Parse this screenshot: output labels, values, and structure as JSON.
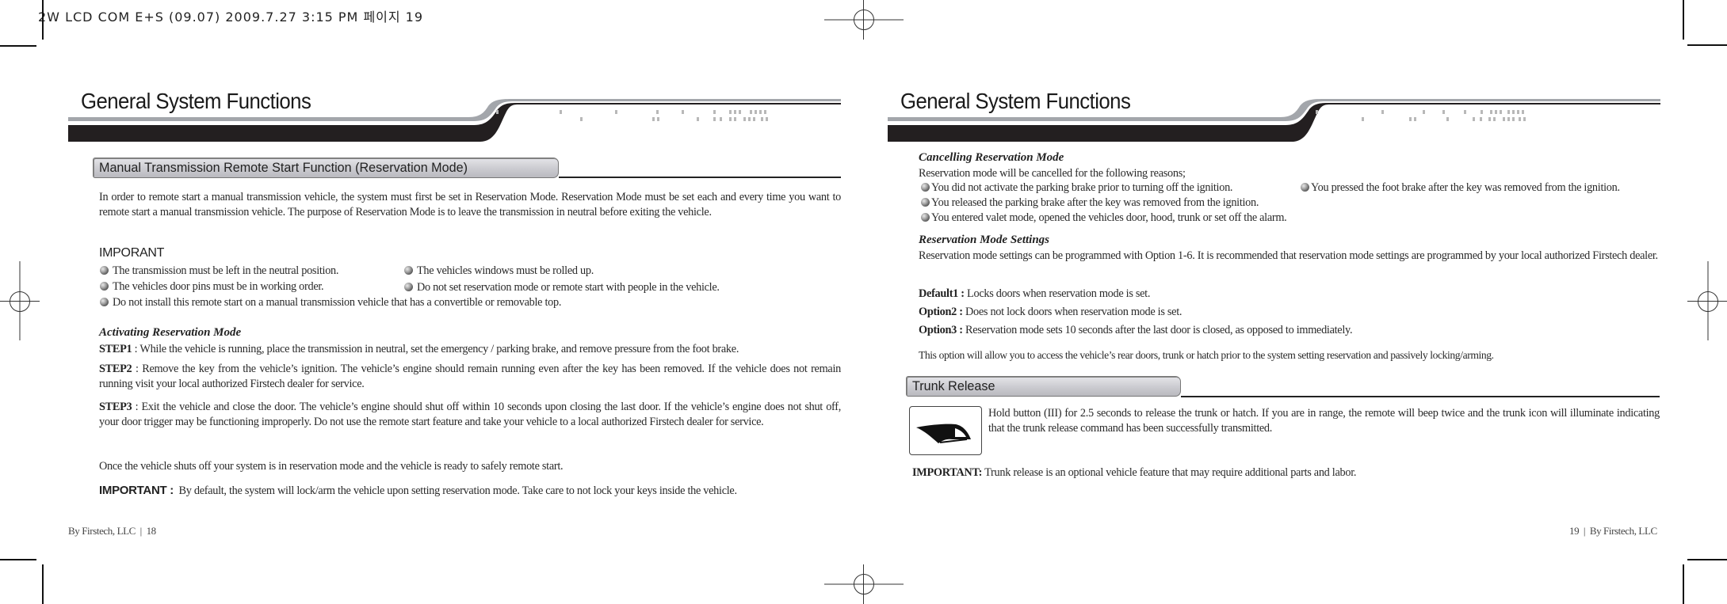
{
  "print_slug": "2W LCD COM E+S (09.07) 2009.7.27 3:15 PM 페이지 19",
  "left_page": {
    "title": "General System Functions",
    "section_title": "Manual Transmission Remote Start Function (Reservation Mode)",
    "intro": "In order to remote start a manual transmission vehicle, the system must first be set in Reservation Mode.  Reservation Mode must be set each and every time you want to remote start a manual transmission vehicle. The purpose of Reservation Mode is to leave the transmission in neutral before exiting the vehicle.",
    "important_heading": "IMPORANT",
    "important_items": [
      "The transmission must be left in the neutral position.",
      "The vehicles windows must be rolled up.",
      "The vehicles door pins must be in working order.",
      "Do not set reservation mode or remote start with people in the vehicle.",
      "Do not install this remote start on a manual transmission vehicle that has a convertible or removable top."
    ],
    "activating_heading": "Activating Reservation Mode",
    "steps": [
      {
        "label": "STEP1",
        "sep": " :  ",
        "text": "While the vehicle is running, place the transmission in neutral, set the emergency / parking brake, and remove pressure from the foot brake."
      },
      {
        "label": "STEP2",
        "sep": " :  ",
        "text": "Remove the key from the vehicle’s ignition. The vehicle’s engine should remain running even after the key has been removed. If the vehicle does not remain running visit your local authorized Firstech dealer for service."
      },
      {
        "label": "STEP3",
        "sep": " :  ",
        "text": "Exit the vehicle and close the door. The vehicle’s engine should shut off within 10 seconds upon closing the last door. If the vehicle’s engine does not shut off, your door trigger may be functioning improperly.  Do not use the remote start feature and take your vehicle to a local authorized Firstech dealer for service."
      }
    ],
    "once_text": "Once the vehicle shuts off your system is in reservation mode and the vehicle is ready to safely remote start.",
    "important_label": "IMPORTANT :",
    "important_text": "By default, the system will lock/arm the vehicle upon setting reservation mode. Take care to not lock your keys inside the vehicle.",
    "footer_company": "By Firstech, LLC",
    "footer_sep": "|",
    "footer_page": "18"
  },
  "right_page": {
    "title": "General System Functions",
    "cancel_heading": "Cancelling Reservation Mode",
    "cancel_intro": "Reservation mode will be cancelled for the following reasons;",
    "cancel_items": [
      "You did not activate the parking brake prior to turning off the ignition.",
      "You pressed the foot brake after the key was removed from the ignition.",
      "You released the parking brake after the key was removed from the ignition.",
      "You entered valet mode, opened the vehicles door, hood, trunk or set off the alarm."
    ],
    "settings_heading": "Reservation Mode Settings",
    "settings_intro": "Reservation mode settings can be programmed with Option 1-6.  It is recommended that reservation mode settings are programmed by your local authorized Firstech dealer.",
    "options": [
      {
        "label": "Default1 :",
        "text": "Locks doors when reservation mode is set."
      },
      {
        "label": "Option2 :",
        "text": "Does not lock doors when reservation mode is set."
      },
      {
        "label": "Option3 :",
        "text": "Reservation mode sets 10 seconds after the last door is closed, as opposed to immediately."
      }
    ],
    "option_note": "This option will allow you to access the vehicle’s rear doors, trunk or hatch prior to the system setting reservation and passively locking/arming.",
    "trunk_section_title": "Trunk Release",
    "trunk_icon": "trunk-open-icon",
    "trunk_text": "Hold button (III) for 2.5 seconds to release the trunk or hatch. If you are in range, the remote will beep twice and the trunk icon will illuminate indicating that the trunk release command has been successfully transmitted.",
    "important_label": "IMPORTANT:",
    "important_text": "Trunk release is an optional vehicle feature that may require additional parts and labor.",
    "footer_page": "19",
    "footer_sep": "|",
    "footer_company": "By Firstech, LLC"
  },
  "colors": {
    "band_gray": "#a3a6ab",
    "band_black": "#231f20",
    "section_bar": "#c9c9ce",
    "text": "#2a2a2a"
  }
}
